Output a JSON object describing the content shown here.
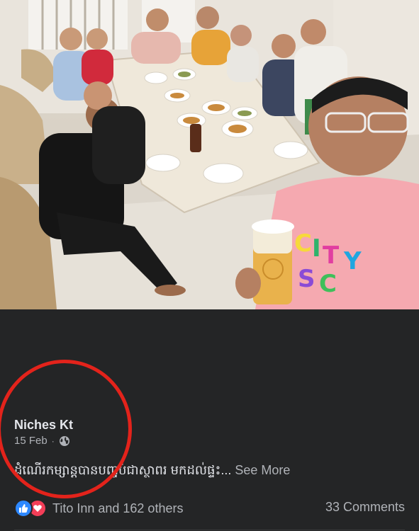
{
  "post": {
    "author": "Niches Kt",
    "date": "15 Feb",
    "separator": "·",
    "caption": "ដំណើរកម្សាន្តបានបញ្ចប់ជាស្ថាពរ មកដល់ផ្ទះ...",
    "see_more": "See More"
  },
  "reactions": {
    "icons": [
      "like-icon",
      "love-icon"
    ],
    "text": "Tito Inn and 162 others"
  },
  "comments": {
    "text": "33 Comments"
  },
  "photo": {
    "description_icon": "group-dinner-photo"
  },
  "colors": {
    "background": "#242526",
    "text_primary": "#e4e6eb",
    "text_secondary": "#b0b3b8",
    "like_blue": "#2d88ff",
    "love_red": "#f33e58",
    "annotation_red": "#e3231b"
  }
}
